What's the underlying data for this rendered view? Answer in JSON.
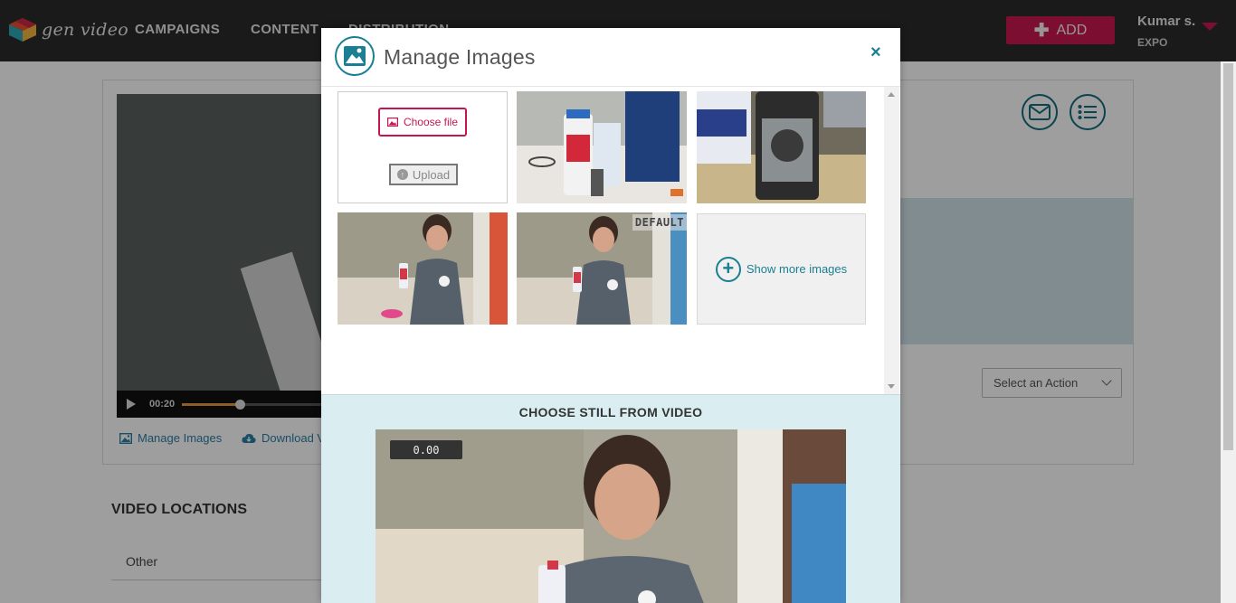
{
  "nav": {
    "logo_text": "gen video",
    "links": [
      "CAMPAIGNS",
      "CONTENT",
      "DISTRIBUTION"
    ],
    "add_label": "ADD",
    "user_name": "Kumar s.",
    "user_org": "EXPO"
  },
  "player": {
    "time": "00:20",
    "progress_fraction": 0.4
  },
  "page": {
    "manage_images_link": "Manage Images",
    "download_link": "Download V",
    "select_action": "Select an Action",
    "video_locations_heading": "VIDEO LOCATIONS",
    "location_row": "Other"
  },
  "modal": {
    "title": "Manage Images",
    "close": "×",
    "choose_file": "Choose file",
    "upload": "Upload",
    "default_badge": "DEFAULT",
    "show_more": "Show more images",
    "still_title": "CHOOSE STILL FROM VIDEO",
    "timecode": "0.00"
  },
  "colors": {
    "brand_pink": "#c8174f",
    "teal": "#1a7f93",
    "nav_bg": "#2b2b2b",
    "still_bg": "#daeef2"
  }
}
